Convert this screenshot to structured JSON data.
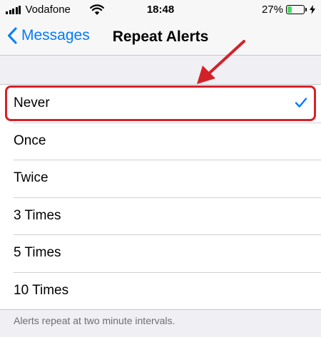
{
  "status_bar": {
    "carrier": "Vodafone",
    "time": "18:48",
    "battery_percent": "27%",
    "battery_level": 0.27,
    "icons": [
      "signal-bars-icon",
      "wifi-icon",
      "battery-icon",
      "charging-bolt-icon"
    ]
  },
  "nav": {
    "back_label": "Messages",
    "title": "Repeat Alerts"
  },
  "options": [
    {
      "label": "Never",
      "selected": true
    },
    {
      "label": "Once",
      "selected": false
    },
    {
      "label": "Twice",
      "selected": false
    },
    {
      "label": "3 Times",
      "selected": false
    },
    {
      "label": "5 Times",
      "selected": false
    },
    {
      "label": "10 Times",
      "selected": false
    }
  ],
  "footer": "Alerts repeat at two minute intervals.",
  "colors": {
    "accent": "#007aff",
    "annotation": "#d42128",
    "battery": "#4cd964"
  }
}
